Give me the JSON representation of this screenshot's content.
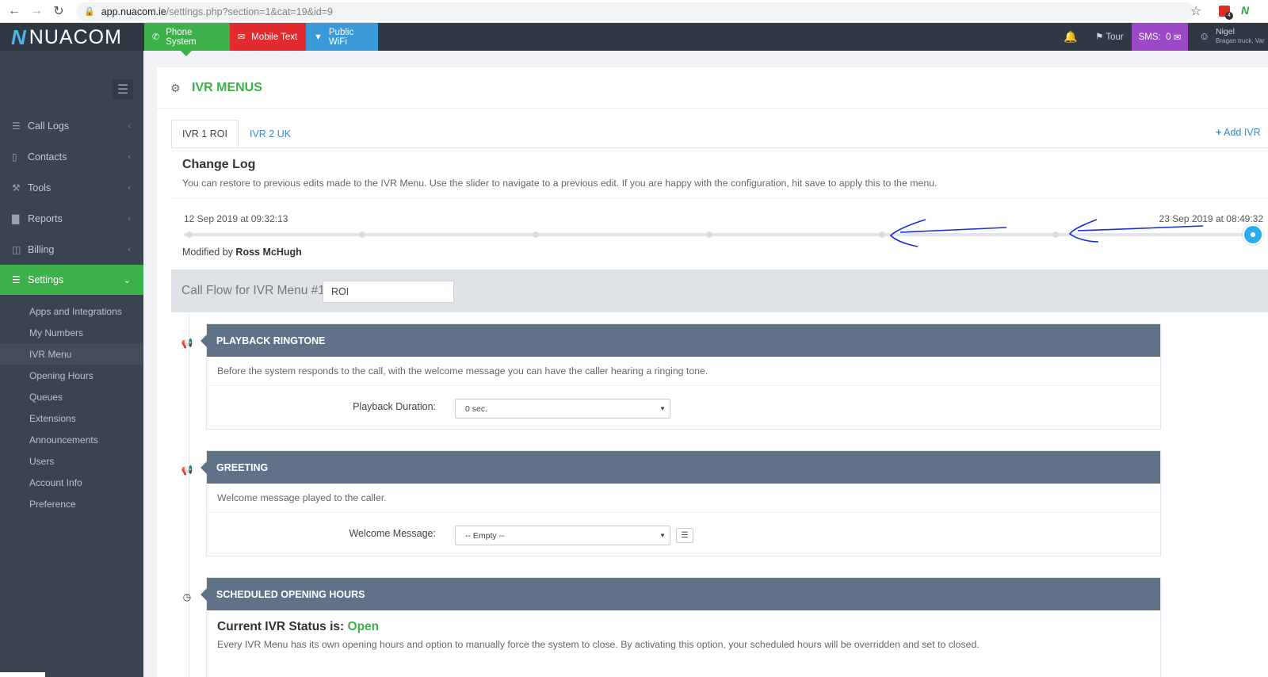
{
  "browser": {
    "url_host": "app.nuacom.ie",
    "url_path": "/settings.php?section=1&cat=19&id=9"
  },
  "app": {
    "logo_text": "NUACOM",
    "topnav": [
      {
        "label": "Phone System",
        "color": "#3cb14a"
      },
      {
        "label": "Mobile Text",
        "color": "#e12b2e"
      },
      {
        "label": "Public WiFi",
        "color": "#3a9ad9"
      }
    ],
    "tour_label": "Tour",
    "sms_label": "SMS:",
    "sms_count": "0",
    "user_name": "Nigel",
    "user_sub": "Bragan truck, Var"
  },
  "sidebar": {
    "items": [
      {
        "label": "Call Logs",
        "icon": "list-icon"
      },
      {
        "label": "Contacts",
        "icon": "contacts-icon"
      },
      {
        "label": "Tools",
        "icon": "wrench-icon"
      },
      {
        "label": "Reports",
        "icon": "bar-chart-icon"
      },
      {
        "label": "Billing",
        "icon": "folder-icon"
      },
      {
        "label": "Settings",
        "icon": "sliders-icon"
      }
    ],
    "sub_items": [
      "Apps and Integrations",
      "My Numbers",
      "IVR Menu",
      "Opening Hours",
      "Queues",
      "Extensions",
      "Announcements",
      "Users",
      "Account Info",
      "Preference"
    ]
  },
  "main": {
    "title": "IVR MENUS",
    "tabs": [
      {
        "label": "IVR 1 ROI"
      },
      {
        "label": "IVR 2 UK"
      }
    ],
    "add_ivr_label": "Add IVR",
    "change_log": {
      "title": "Change Log",
      "description": "You can restore to previous edits made to the IVR Menu. Use the slider to navigate to a previous edit. If you are happy with the configuration, hit save to apply this to the menu.",
      "start_date": "12 Sep 2019 at 09:32:13",
      "end_date": "23 Sep 2019 at 08:49:32",
      "modified_prefix": "Modified by",
      "modified_by": "Ross McHugh"
    },
    "call_flow": {
      "label": "Call Flow for IVR Menu #1",
      "value": "ROI"
    },
    "playback": {
      "title": "PLAYBACK RINGTONE",
      "description": "Before the system responds to the call, with the welcome message you can have the caller hearing a ringing tone.",
      "field_label": "Playback Duration:",
      "value": "0 sec."
    },
    "greeting": {
      "title": "GREETING",
      "description": "Welcome message played to the caller.",
      "field_label": "Welcome Message:",
      "value": "-- Empty --"
    },
    "opening": {
      "title": "SCHEDULED OPENING HOURS",
      "status_prefix": "Current IVR Status is:",
      "status": "Open",
      "description": "Every IVR Menu has its own opening hours and option to manually force the system to close. By activating this option, your scheduled hours will be overridden and set to closed."
    }
  }
}
